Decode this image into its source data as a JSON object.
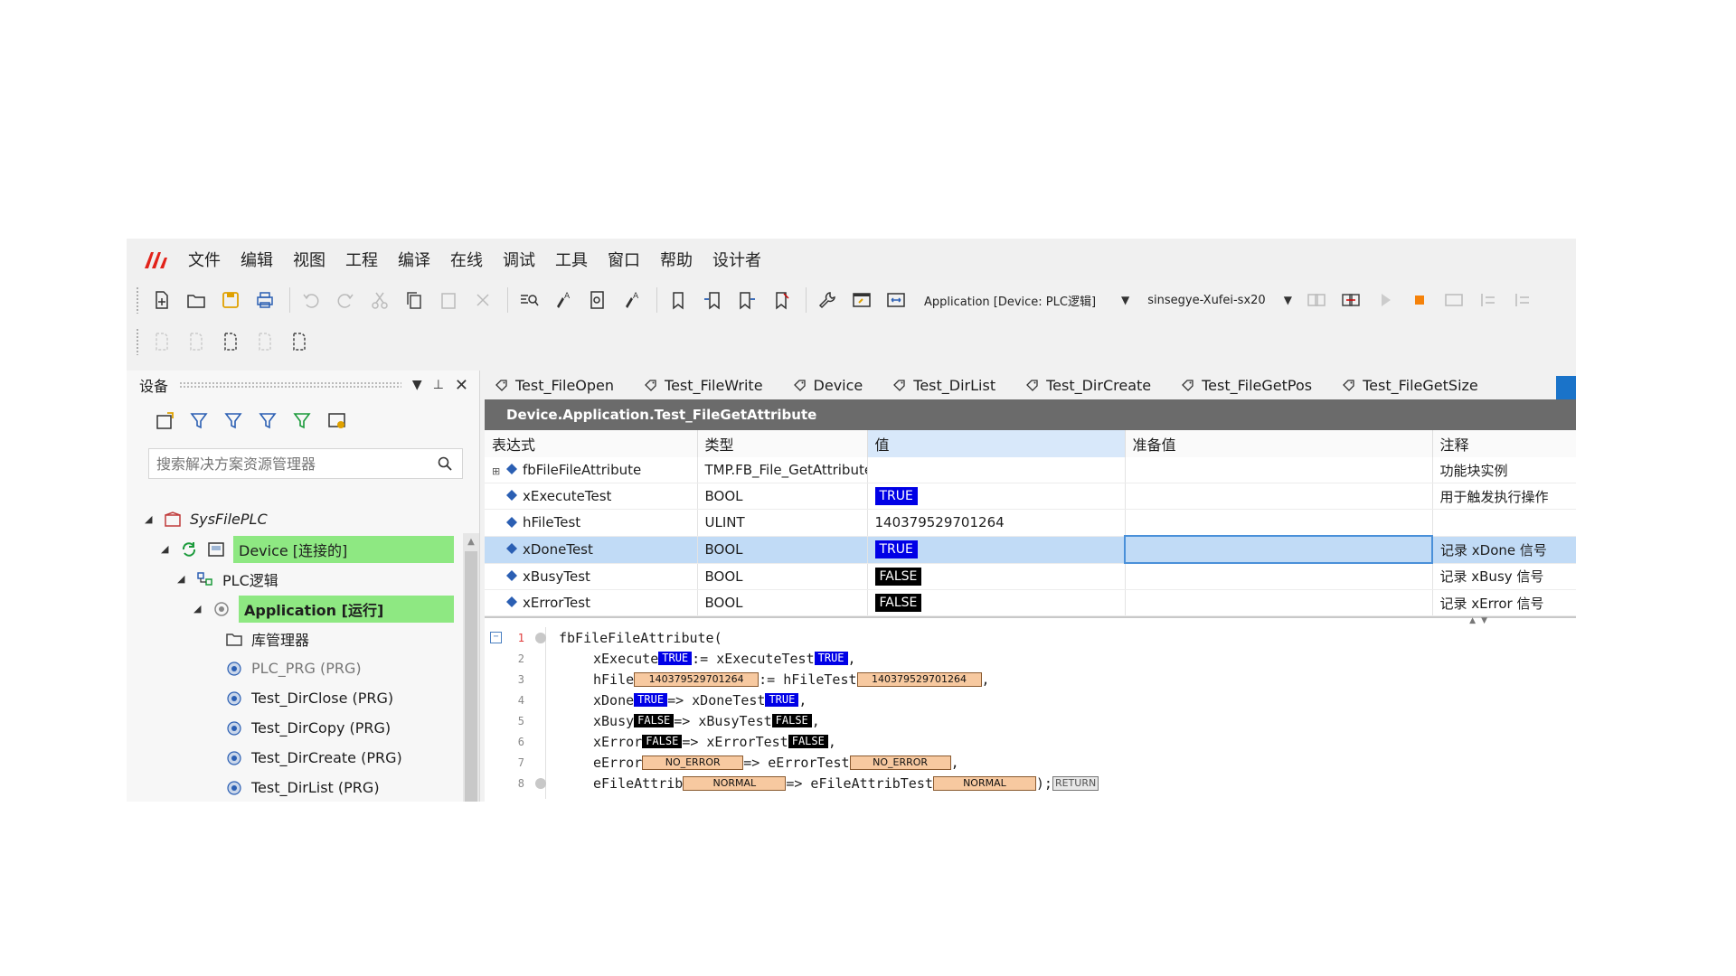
{
  "menu": [
    "文件",
    "编辑",
    "视图",
    "工程",
    "编译",
    "在线",
    "调试",
    "工具",
    "窗口",
    "帮助",
    "设计者"
  ],
  "toolbar": {
    "application_combo": "Application [Device: PLC逻辑]",
    "device_combo": "sinsegye-Xufei-sx20"
  },
  "devices_panel": {
    "title": "设备",
    "search_placeholder": "搜索解决方案资源管理器",
    "tree": [
      {
        "label": "SysFilePLC",
        "italic": true
      },
      {
        "label": "Device [连接的]",
        "highlight": true
      },
      {
        "label": "PLC逻辑"
      },
      {
        "label": "Application [运行]",
        "highlight": true,
        "bold": true
      },
      {
        "label": "库管理器"
      },
      {
        "label": "PLC_PRG (PRG)"
      },
      {
        "label": "Test_DirClose (PRG)"
      },
      {
        "label": "Test_DirCopy (PRG)"
      },
      {
        "label": "Test_DirCreate (PRG)"
      },
      {
        "label": "Test_DirList (PRG)"
      }
    ]
  },
  "tabs": [
    "Test_FileOpen",
    "Test_FileWrite",
    "Device",
    "Test_DirList",
    "Test_DirCreate",
    "Test_FileGetPos",
    "Test_FileGetSize"
  ],
  "editor": {
    "title": "Device.Application.Test_FileGetAttribute",
    "columns": [
      "表达式",
      "类型",
      "值",
      "准备值",
      "注释"
    ],
    "rows": [
      {
        "expr": "fbFileFileAttribute",
        "type": "TMP.FB_File_GetAttribute",
        "value": "",
        "comment": "功能块实例"
      },
      {
        "expr": "xExecuteTest",
        "type": "BOOL",
        "value": "TRUE",
        "comment": "用于触发执行操作"
      },
      {
        "expr": "hFileTest",
        "type": "ULINT",
        "value": "140379529701264",
        "comment": ""
      },
      {
        "expr": "xDoneTest",
        "type": "BOOL",
        "value": "TRUE",
        "comment": "记录 xDone 信号"
      },
      {
        "expr": "xBusyTest",
        "type": "BOOL",
        "value": "FALSE",
        "comment": "记录 xBusy 信号"
      },
      {
        "expr": "xErrorTest",
        "type": "BOOL",
        "value": "FALSE",
        "comment": "记录 xError 信号"
      }
    ],
    "code": {
      "line_numbers": [
        "1",
        "2",
        "3",
        "4",
        "5",
        "6",
        "7",
        "8"
      ],
      "l1": "fbFileFileAttribute(",
      "l2": {
        "a": "xExecute",
        "v1": "TRUE",
        "op": ":= xExecuteTest",
        "v2": "TRUE",
        "end": ","
      },
      "l3": {
        "a": "hFile",
        "v1": "140379529701264",
        "op": ":= hFileTest",
        "v2": "140379529701264",
        "end": ","
      },
      "l4": {
        "a": "xDone",
        "v1": "TRUE",
        "op": "=> xDoneTest",
        "v2": "TRUE",
        "end": ","
      },
      "l5": {
        "a": "xBusy",
        "v1": "FALSE",
        "op": "=> xBusyTest",
        "v2": "FALSE",
        "end": ","
      },
      "l6": {
        "a": "xError",
        "v1": "FALSE",
        "op": "=> xErrorTest",
        "v2": "FALSE",
        "end": ","
      },
      "l7": {
        "a": "eError",
        "v1": "NO_ERROR",
        "op": "=> eErrorTest",
        "v2": "NO_ERROR",
        "end": ","
      },
      "l8": {
        "a": "eFileAttrib",
        "v1": "NORMAL",
        "op": "=> eFileAttribTest",
        "v2": "NORMAL",
        "end": ");",
        "ret": "RETURN"
      }
    }
  },
  "colors": {
    "bool_true": "#0000e6",
    "bool_false": "#000000",
    "highlight_green": "#8ee882",
    "selection": "#c1dbf6",
    "title_bar": "#6b6b6b"
  }
}
